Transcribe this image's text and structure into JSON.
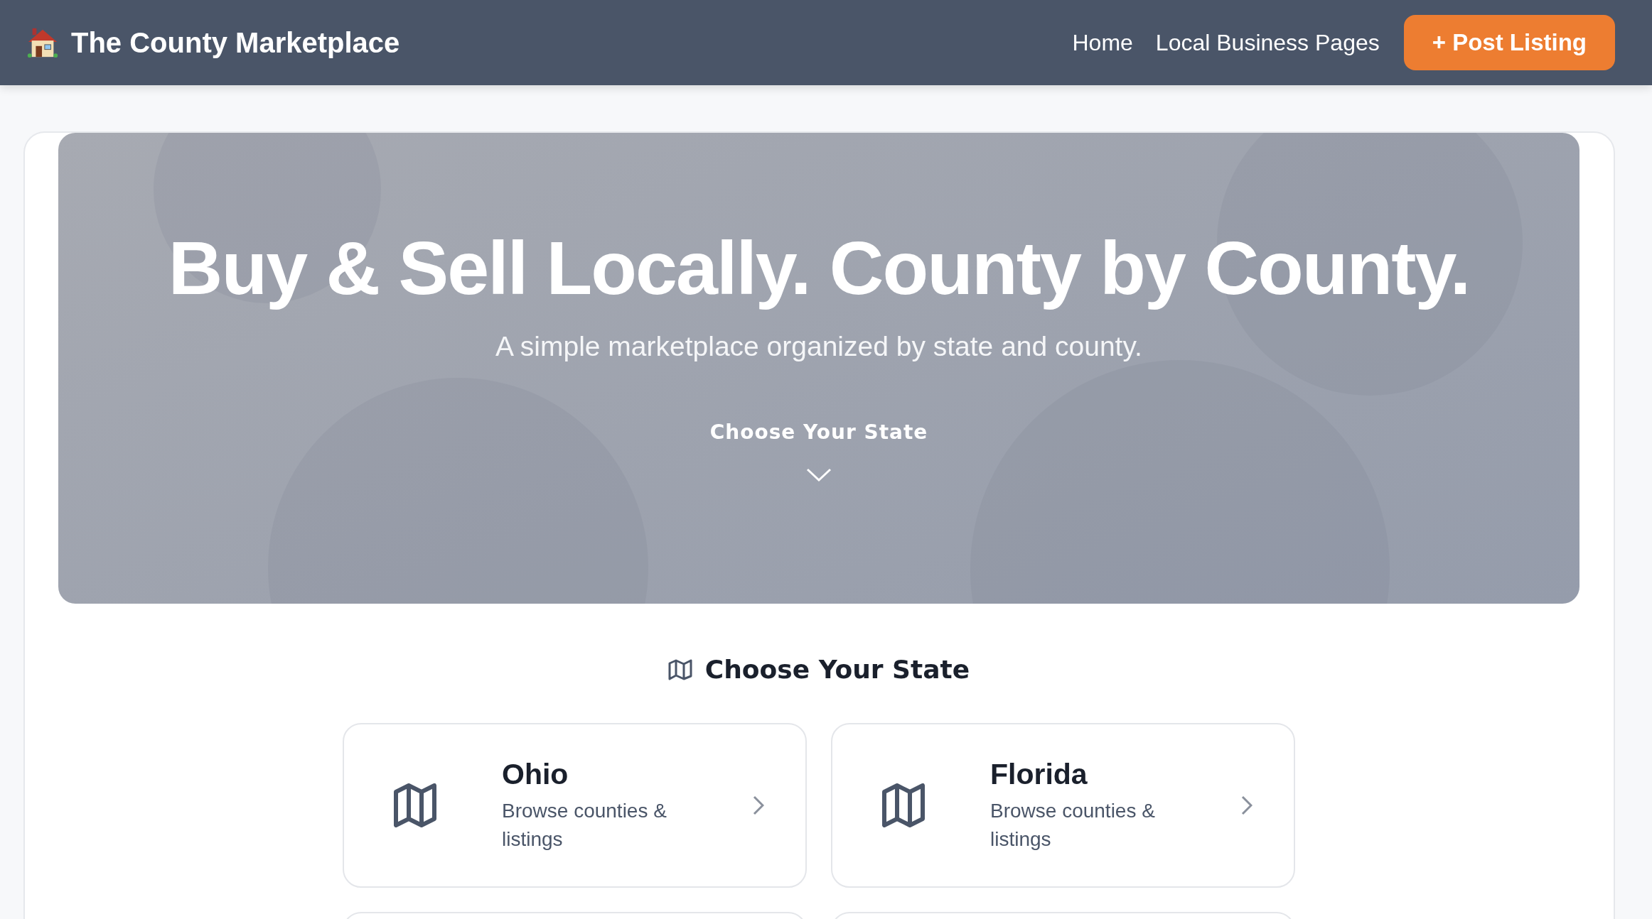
{
  "header": {
    "title": "The County Marketplace",
    "nav": [
      "Home",
      "Local Business Pages"
    ],
    "post_button": "+ Post Listing"
  },
  "hero": {
    "title": "Buy & Sell Locally. County by County.",
    "subtitle": "A simple marketplace organized by state and county.",
    "cta": "Choose Your State"
  },
  "states_section": {
    "heading": "Choose Your State",
    "states": [
      {
        "name": "Ohio",
        "description": "Browse counties & listings"
      },
      {
        "name": "Florida",
        "description": "Browse counties & listings"
      }
    ]
  }
}
